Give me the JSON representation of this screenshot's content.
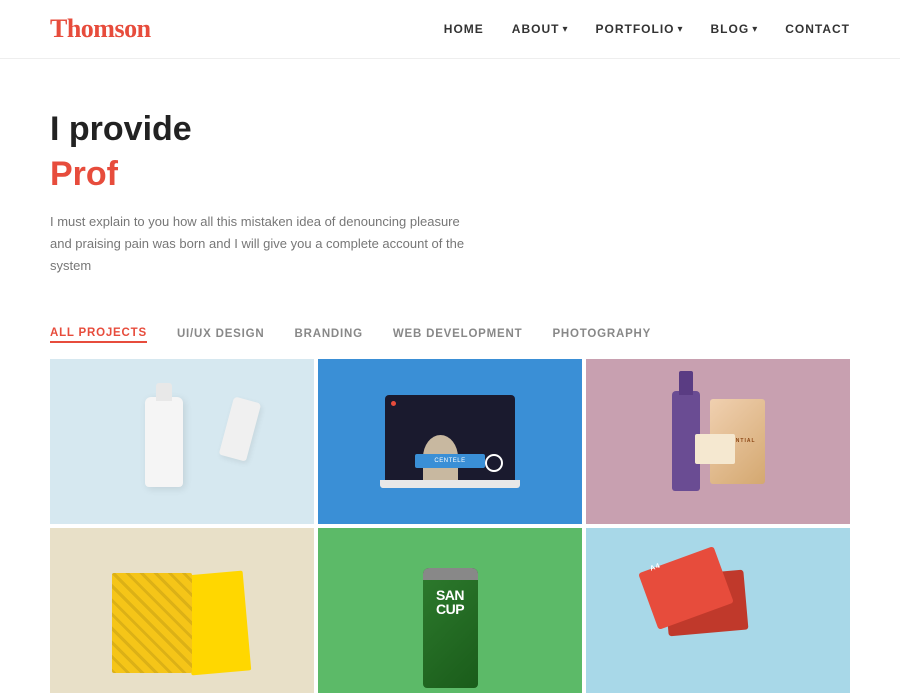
{
  "header": {
    "logo_text_black": "Thom",
    "logo_text_red": "son",
    "nav": {
      "home": "HOME",
      "about": "ABOUT",
      "portfolio": "PORTFOLIO",
      "blog": "BLOG",
      "contact": "CONTACT"
    }
  },
  "hero": {
    "headline": "I provide",
    "headline_red": "Prof",
    "description": "I must explain to you how all this mistaken idea of denouncing pleasure and praising pain was born and I will give you a complete account of the system"
  },
  "filters": {
    "tabs": [
      {
        "id": "all",
        "label": "ALL PROJECTS",
        "active": true
      },
      {
        "id": "uiux",
        "label": "UI/UX DESIGN",
        "active": false
      },
      {
        "id": "branding",
        "label": "BRANDING",
        "active": false
      },
      {
        "id": "webdev",
        "label": "WEB DEVELOPMENT",
        "active": false
      },
      {
        "id": "photo",
        "label": "PHOTOGRAPHY",
        "active": false
      }
    ]
  },
  "portfolio": {
    "items": [
      {
        "id": 1,
        "type": "cosmetics",
        "bg": "#d6e8f0"
      },
      {
        "id": 2,
        "type": "laptop",
        "bg": "#3a8fd6"
      },
      {
        "id": 3,
        "type": "wine",
        "bg": "#c8a0b0"
      },
      {
        "id": 4,
        "type": "brochure",
        "bg": "#e8e0c8"
      },
      {
        "id": 5,
        "type": "can",
        "bg": "#5cba68"
      },
      {
        "id": 6,
        "type": "cards",
        "bg": "#a8d8e8"
      }
    ],
    "can_label_line1": "SAN",
    "can_label_line2": "CUP",
    "wine_title": "ESSENTIAL",
    "card_text": "A4"
  }
}
